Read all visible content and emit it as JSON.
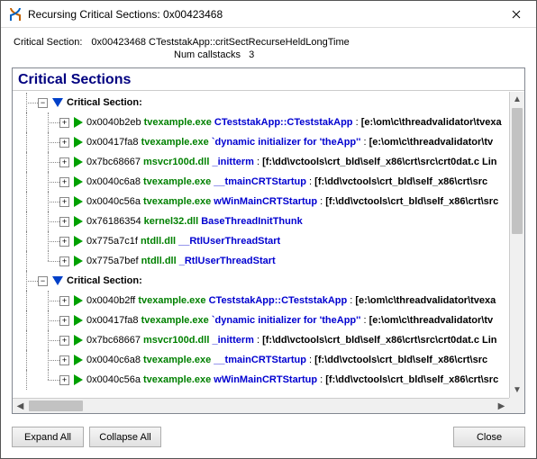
{
  "window": {
    "title": "Recursing Critical Sections: 0x00423468"
  },
  "info": {
    "label": "Critical Section:",
    "value": "0x00423468 CTeststakApp::critSectRecurseHeldLongTime",
    "subLabel": "Num callstacks",
    "subValue": "3"
  },
  "treeHeader": "Critical Sections",
  "sections": [
    {
      "header": "Critical Section:",
      "items": [
        {
          "addr": "0x0040b2eb",
          "mod": "tvexample.exe",
          "sym": "CTeststakApp::CTeststakApp",
          "path": "[e:\\om\\c\\threadvalidator\\tvexa"
        },
        {
          "addr": "0x00417fa8",
          "mod": "tvexample.exe",
          "sym": "`dynamic initializer for 'theApp''",
          "path": "[e:\\om\\c\\threadvalidator\\tv"
        },
        {
          "addr": "0x7bc68667",
          "mod": "msvcr100d.dll",
          "sym": "_initterm",
          "path": "[f:\\dd\\vctools\\crt_bld\\self_x86\\crt\\src\\crt0dat.c Lin"
        },
        {
          "addr": "0x0040c6a8",
          "mod": "tvexample.exe",
          "sym": "__tmainCRTStartup",
          "path": "[f:\\dd\\vctools\\crt_bld\\self_x86\\crt\\src"
        },
        {
          "addr": "0x0040c56a",
          "mod": "tvexample.exe",
          "sym": "wWinMainCRTStartup",
          "path": "[f:\\dd\\vctools\\crt_bld\\self_x86\\crt\\src"
        },
        {
          "addr": "0x76186354",
          "mod": "kernel32.dll",
          "sym": "BaseThreadInitThunk",
          "path": ""
        },
        {
          "addr": "0x775a7c1f",
          "mod": "ntdll.dll",
          "sym": "__RtlUserThreadStart",
          "path": ""
        },
        {
          "addr": "0x775a7bef",
          "mod": "ntdll.dll",
          "sym": "_RtlUserThreadStart",
          "path": ""
        }
      ]
    },
    {
      "header": "Critical Section:",
      "items": [
        {
          "addr": "0x0040b2ff",
          "mod": "tvexample.exe",
          "sym": "CTeststakApp::CTeststakApp",
          "path": "[e:\\om\\c\\threadvalidator\\tvexa"
        },
        {
          "addr": "0x00417fa8",
          "mod": "tvexample.exe",
          "sym": "`dynamic initializer for 'theApp''",
          "path": "[e:\\om\\c\\threadvalidator\\tv"
        },
        {
          "addr": "0x7bc68667",
          "mod": "msvcr100d.dll",
          "sym": "_initterm",
          "path": "[f:\\dd\\vctools\\crt_bld\\self_x86\\crt\\src\\crt0dat.c Lin"
        },
        {
          "addr": "0x0040c6a8",
          "mod": "tvexample.exe",
          "sym": "__tmainCRTStartup",
          "path": "[f:\\dd\\vctools\\crt_bld\\self_x86\\crt\\src"
        },
        {
          "addr": "0x0040c56a",
          "mod": "tvexample.exe",
          "sym": "wWinMainCRTStartup",
          "path": "[f:\\dd\\vctools\\crt_bld\\self_x86\\crt\\src"
        }
      ]
    }
  ],
  "buttons": {
    "expandAll": "Expand All",
    "collapseAll": "Collapse All",
    "close": "Close"
  }
}
